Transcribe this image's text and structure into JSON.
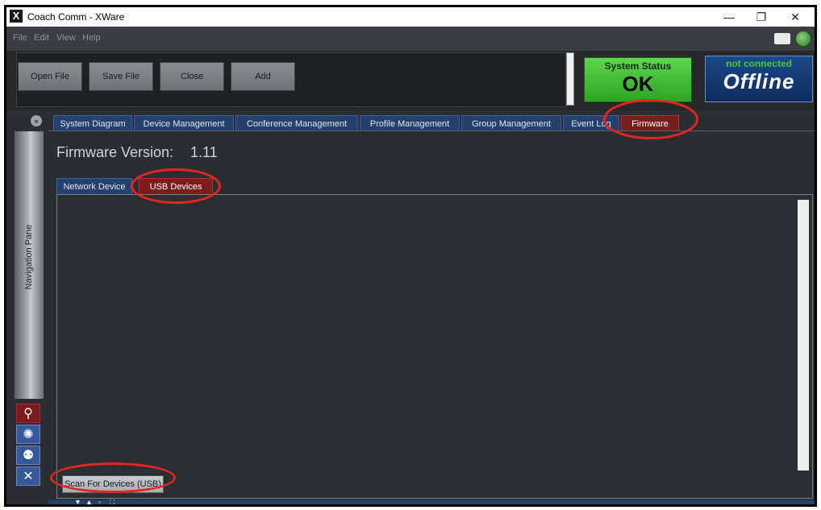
{
  "window": {
    "title": "Coach Comm - XWare",
    "minimize_glyph": "—",
    "restore_glyph": "❐",
    "close_glyph": "✕"
  },
  "menu": [
    "File",
    "Edit",
    "View",
    "Help"
  ],
  "toolbar": {
    "open": "Open File",
    "save": "Save File",
    "close": "Close",
    "add": "Add"
  },
  "status": {
    "title": "System Status",
    "value": "OK",
    "color": "#3cc02e"
  },
  "connection": {
    "title": "not connected",
    "value": "Offline",
    "title_color": "#49c93a"
  },
  "tabs": [
    {
      "label": "System Diagram"
    },
    {
      "label": "Device Management"
    },
    {
      "label": "Conference Management"
    },
    {
      "label": "Profile Management"
    },
    {
      "label": "Group Management"
    },
    {
      "label": "Event Log"
    },
    {
      "label": "Firmware",
      "active": true
    }
  ],
  "nav": {
    "label": "Navigation Pane",
    "icons": [
      "binoculars-icon",
      "devices-icon",
      "users-icon",
      "tools-icon"
    ]
  },
  "firmware": {
    "label": "Firmware Version:",
    "version": "1.11",
    "subtabs": [
      {
        "label": "Network Device"
      },
      {
        "label": "USB Devices",
        "active": true
      }
    ],
    "scan_button": "Scan For Devices (USB)"
  },
  "colors": {
    "active_tab": "#7b1d1d",
    "inactive_tab": "#23406e",
    "annotation": "#e8241f"
  }
}
